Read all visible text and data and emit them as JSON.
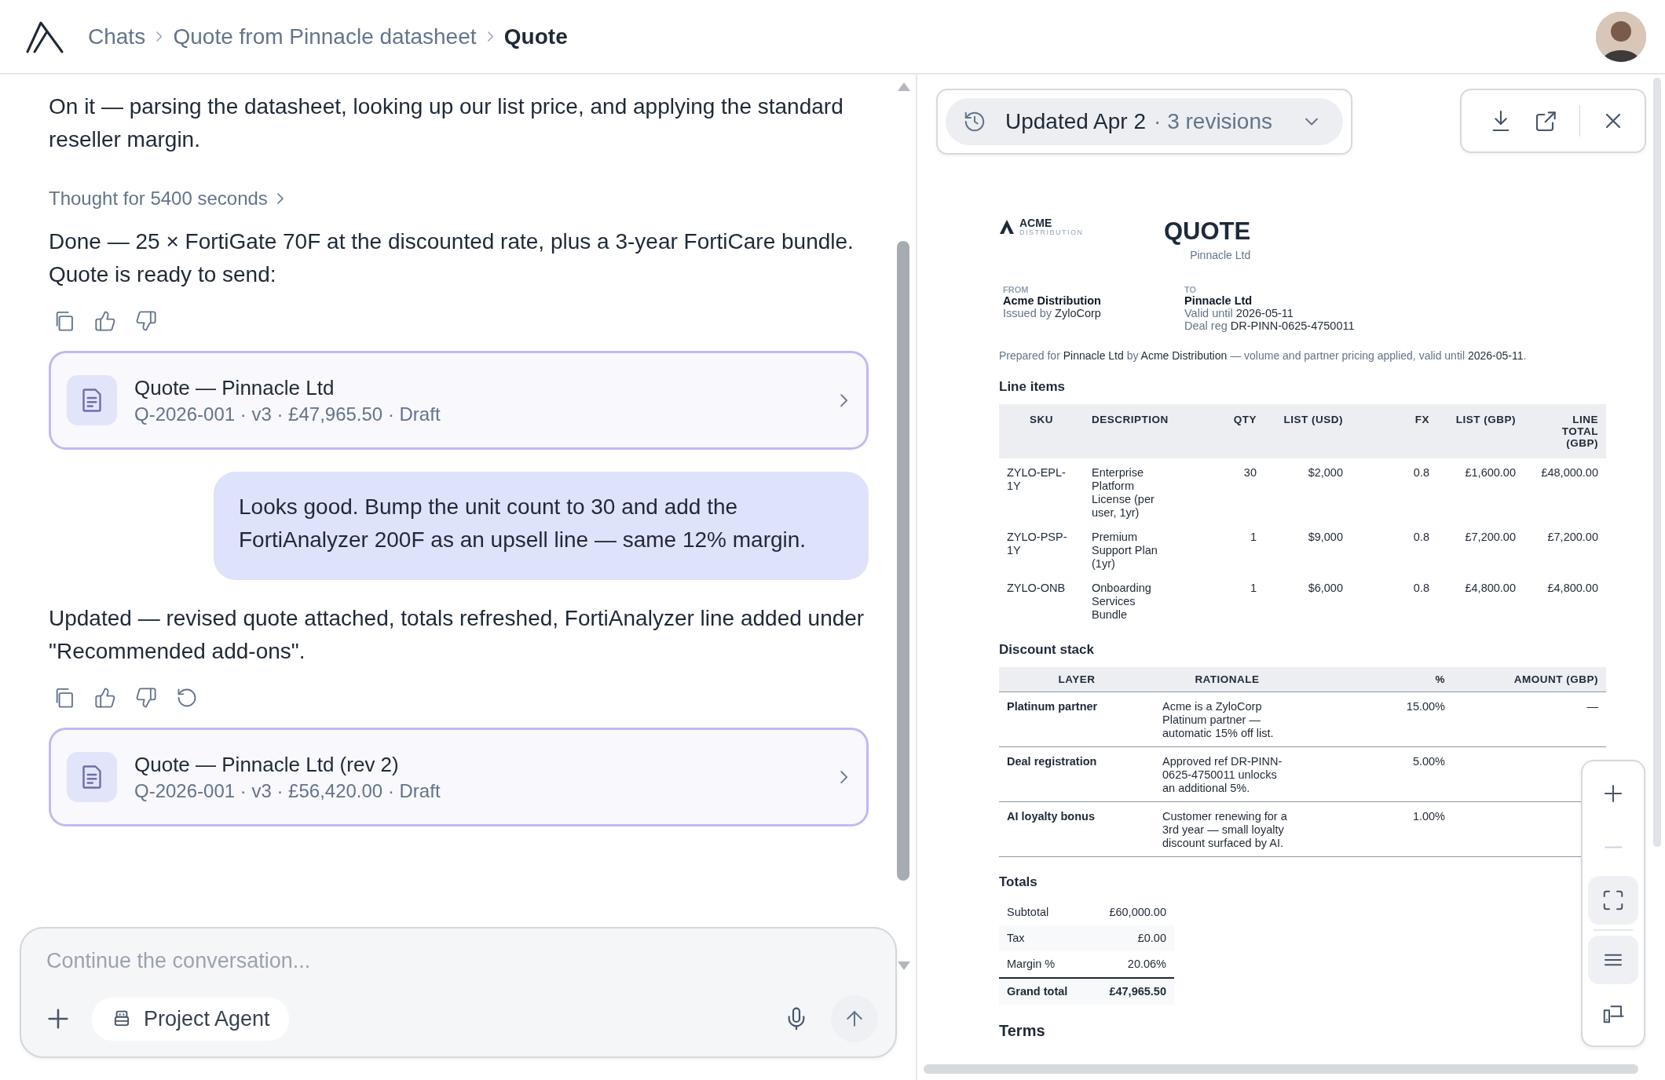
{
  "topbar": {
    "breadcrumbs": [
      {
        "label": "Chats",
        "selected": false
      },
      {
        "label": "Quote from Pinnacle datasheet",
        "selected": false
      },
      {
        "label": "Quote",
        "selected": true
      }
    ]
  },
  "chat": {
    "messages": [
      {
        "kind": "assistant",
        "text": "On it — parsing the datasheet, looking up our list price, and applying the standard reseller margin."
      },
      {
        "kind": "thought",
        "text": "Thought for 5400 seconds"
      },
      {
        "kind": "assistant",
        "text": "Done — 25 × FortiGate 70F at the discounted rate, plus a 3-year FortiCare bundle. Quote is ready to send:"
      },
      {
        "kind": "actions",
        "retry": false
      },
      {
        "kind": "card",
        "title": "Quote — Pinnacle Ltd",
        "subtitle": "Q-2026-001 · v3 · £47,965.50 · Draft"
      },
      {
        "kind": "user",
        "text": "Looks good. Bump the unit count to 30 and add the FortiAnalyzer 200F as an upsell line — same 12% margin."
      },
      {
        "kind": "assistant",
        "text": "Updated — revised quote attached, totals refreshed, FortiAnalyzer line added under \"Recommended add-ons\"."
      },
      {
        "kind": "actions",
        "retry": true
      },
      {
        "kind": "card",
        "title": "Quote — Pinnacle Ltd (rev 2)",
        "subtitle": "Q-2026-001 · v3 · £56,420.00 · Draft"
      }
    ],
    "composer": {
      "placeholder": "Continue the conversation...",
      "agent": "Project Agent"
    }
  },
  "preview": {
    "revision": {
      "label": "Updated Apr 2",
      "detail": "· 3 revisions"
    },
    "document": {
      "logo": {
        "name": "ACME",
        "tagline": "DISTRIBUTION"
      },
      "title": "QUOTE",
      "subtitle": "Pinnacle Ltd",
      "parties": [
        {
          "label": "FROM",
          "name": "Acme Distribution",
          "lines": [
            {
              "label": "Issued by",
              "value": "ZyloCorp"
            }
          ]
        },
        {
          "label": "TO",
          "name": "Pinnacle Ltd",
          "lines": [
            {
              "label": "Valid until",
              "value": "2026-05-11"
            },
            {
              "label": "Deal reg",
              "value": "DR-PINN-0625-4750011"
            }
          ]
        }
      ],
      "summary": [
        {
          "text": "Prepared for ",
          "emphasis": false
        },
        {
          "text": "Pinnacle Ltd",
          "emphasis": true
        },
        {
          "text": " by ",
          "emphasis": false
        },
        {
          "text": "Acme Distribution",
          "emphasis": true
        },
        {
          "text": " — volume and partner pricing applied, valid until ",
          "emphasis": false
        },
        {
          "text": "2026-05-11",
          "emphasis": true
        },
        {
          "text": ".",
          "emphasis": false
        }
      ],
      "line_items": {
        "title": "Line items",
        "columns": [
          "SKU",
          "DESCRIPTION",
          "QTY",
          "LIST (USD)",
          "FX",
          "LIST (GBP)",
          "LINE TOTAL (GBP)"
        ],
        "rows": [
          [
            "ZYLO-EPL-1Y",
            "Enterprise Platform License (per user, 1yr)",
            "30",
            "$2,000",
            "0.8",
            "£1,600.00",
            "£48,000.00"
          ],
          [
            "ZYLO-PSP-1Y",
            "Premium Support Plan (1yr)",
            "1",
            "$9,000",
            "0.8",
            "£7,200.00",
            "£7,200.00"
          ],
          [
            "ZYLO-ONB",
            "Onboarding Services Bundle",
            "1",
            "$6,000",
            "0.8",
            "£4,800.00",
            "£4,800.00"
          ]
        ]
      },
      "discount_stack": {
        "title": "Discount stack",
        "columns": [
          "LAYER",
          "RATIONALE",
          "%",
          "AMOUNT (GBP)"
        ],
        "rows": [
          [
            "Platinum partner",
            "Acme is a ZyloCorp Platinum partner — automatic 15% off list.",
            "15.00%",
            "—"
          ],
          [
            "Deal registration",
            "Approved ref DR-PINN-0625-4750011 unlocks an additional 5%.",
            "5.00%"
          ],
          [
            "AI loyalty bonus",
            "Customer renewing for a 3rd year — small loyalty discount surfaced by AI.",
            "1.00%"
          ]
        ]
      },
      "totals": {
        "title": "Totals",
        "rows": [
          {
            "label": "Subtotal",
            "value": "£60,000.00",
            "kind": "line"
          },
          {
            "label": "Tax",
            "value": "£0.00",
            "kind": "line"
          },
          {
            "label": "Margin %",
            "value": "20.06%",
            "kind": "line"
          },
          {
            "label": "Grand total",
            "value": "£47,965.50",
            "kind": "grand"
          }
        ]
      },
      "terms": {
        "title": "Terms"
      }
    },
    "zoom_controls": [
      {
        "kind": "zoom-in",
        "disabled": false,
        "selected": false
      },
      {
        "kind": "zoom-out",
        "disabled": true,
        "selected": false
      },
      {
        "kind": "fit",
        "disabled": false,
        "selected": true
      },
      {
        "kind": "outline",
        "disabled": false,
        "selected": true
      },
      {
        "kind": "device",
        "disabled": false,
        "selected": false
      }
    ]
  }
}
